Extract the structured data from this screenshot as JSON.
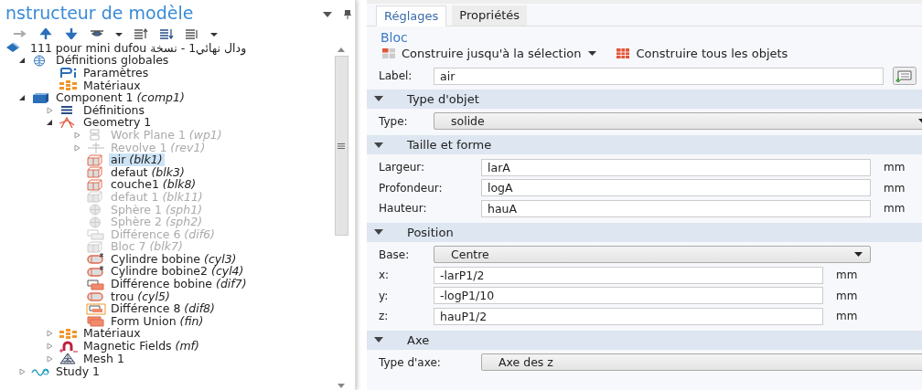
{
  "builder": {
    "title": "nstructeur de modèle",
    "tree": [
      {
        "label": "111 pour mini dufou ودال نهائي1 - نسخة",
        "kind": "model",
        "selected": false,
        "children": [
          {
            "label": "Définitions globales",
            "kind": "globe",
            "expanded": true,
            "selected": false,
            "children": [
              {
                "label": "Paramètres",
                "kind": "pi",
                "selected": false
              },
              {
                "label": "Matériaux",
                "kind": "materials",
                "selected": false
              }
            ]
          },
          {
            "label": "Component 1 *(comp1)*",
            "kind": "component",
            "expanded": true,
            "selected": false,
            "children": [
              {
                "label": "Définitions",
                "kind": "list",
                "expanded": false,
                "selected": false
              },
              {
                "label": "Geometry 1",
                "kind": "geometry",
                "expanded": true,
                "selected": false,
                "children": [
                  {
                    "label": "Work Plane 1 *(wp1)*",
                    "kind": "workplane",
                    "expanded": false,
                    "disabled": true,
                    "selected": false
                  },
                  {
                    "label": "Revolve 1 *(rev1)*",
                    "kind": "revolve",
                    "expanded": false,
                    "disabled": true,
                    "selected": false
                  },
                  {
                    "label": "air *(blk1)*",
                    "kind": "block",
                    "disabled": false,
                    "selected": true
                  },
                  {
                    "label": "defaut *(blk3)*",
                    "kind": "block",
                    "disabled": false,
                    "selected": false
                  },
                  {
                    "label": "couche1 *(blk8)*",
                    "kind": "block",
                    "disabled": false,
                    "selected": false
                  },
                  {
                    "label": "defaut 1 *(blk11)*",
                    "kind": "block",
                    "disabled": true,
                    "selected": false
                  },
                  {
                    "label": "Sphère 1 *(sph1)*",
                    "kind": "sphere",
                    "disabled": true,
                    "selected": false
                  },
                  {
                    "label": "Sphère 2 *(sph2)*",
                    "kind": "sphere",
                    "disabled": true,
                    "selected": false
                  },
                  {
                    "label": "Différence 6 *(dif6)*",
                    "kind": "difference",
                    "disabled": true,
                    "selected": false
                  },
                  {
                    "label": "Bloc 7 *(blk7)*",
                    "kind": "block",
                    "disabled": true,
                    "selected": false
                  },
                  {
                    "label": "Cylindre bobine *(cyl3)*",
                    "kind": "cylinder-star",
                    "disabled": false,
                    "selected": false
                  },
                  {
                    "label": "Cylindre bobine2 *(cyl4)*",
                    "kind": "cylinder-star",
                    "disabled": false,
                    "selected": false
                  },
                  {
                    "label": "Différence bobine *(dif7)*",
                    "kind": "difference",
                    "disabled": false,
                    "selected": false
                  },
                  {
                    "label": "trou *(cyl5)*",
                    "kind": "cylinder",
                    "disabled": false,
                    "selected": false
                  },
                  {
                    "label": "Différence 8 *(dif8)*",
                    "kind": "difference-framed",
                    "disabled": false,
                    "selected": false
                  },
                  {
                    "label": "Form Union *(fin)*",
                    "kind": "union",
                    "disabled": false,
                    "selected": false
                  }
                ]
              },
              {
                "label": "Matériaux",
                "kind": "materials",
                "expanded": false,
                "selected": false
              },
              {
                "label": "Magnetic Fields *(mf)*",
                "kind": "magnet",
                "expanded": false,
                "selected": false
              },
              {
                "label": "Mesh 1",
                "kind": "mesh",
                "expanded": false,
                "selected": false
              }
            ]
          },
          {
            "label": "Study 1",
            "kind": "study",
            "expanded": false,
            "selected": false
          }
        ]
      }
    ]
  },
  "settings": {
    "tabs": [
      {
        "label": "Réglages",
        "selected": true
      },
      {
        "label": "Propriétés",
        "selected": false
      }
    ],
    "heading": "Bloc",
    "actions": [
      {
        "label": "Construire jusqu'à la sélection",
        "kind": "build-selected"
      },
      {
        "label": "Construire tous les objets",
        "kind": "build-all"
      }
    ],
    "label_field": {
      "label": "Label:",
      "value": "air"
    },
    "sections": [
      {
        "title": "Type d'objet",
        "expanded": true,
        "rows": [
          {
            "kind": "select",
            "label": "Type:",
            "value": "solide"
          }
        ]
      },
      {
        "title": "Taille et forme",
        "expanded": true,
        "rows": [
          {
            "kind": "text",
            "label": "Largeur:",
            "value": "larA",
            "unit": "mm"
          },
          {
            "kind": "text",
            "label": "Profondeur:",
            "value": "logA",
            "unit": "mm"
          },
          {
            "kind": "text",
            "label": "Hauteur:",
            "value": "hauA",
            "unit": "mm"
          }
        ]
      },
      {
        "title": "Position",
        "expanded": true,
        "rows": [
          {
            "kind": "select",
            "label": "Base:",
            "value": "Centre"
          },
          {
            "kind": "text",
            "label": "x:",
            "value": "-larP1/2",
            "unit": "mm"
          },
          {
            "kind": "text",
            "label": "y:",
            "value": "-logP1/10",
            "unit": "mm"
          },
          {
            "kind": "text",
            "label": "z:",
            "value": "hauP1/2",
            "unit": "mm"
          }
        ]
      },
      {
        "title": "Axe",
        "expanded": true,
        "rows": [
          {
            "kind": "select",
            "label": "Type d'axe:",
            "value": "Axe des z"
          }
        ]
      }
    ]
  }
}
